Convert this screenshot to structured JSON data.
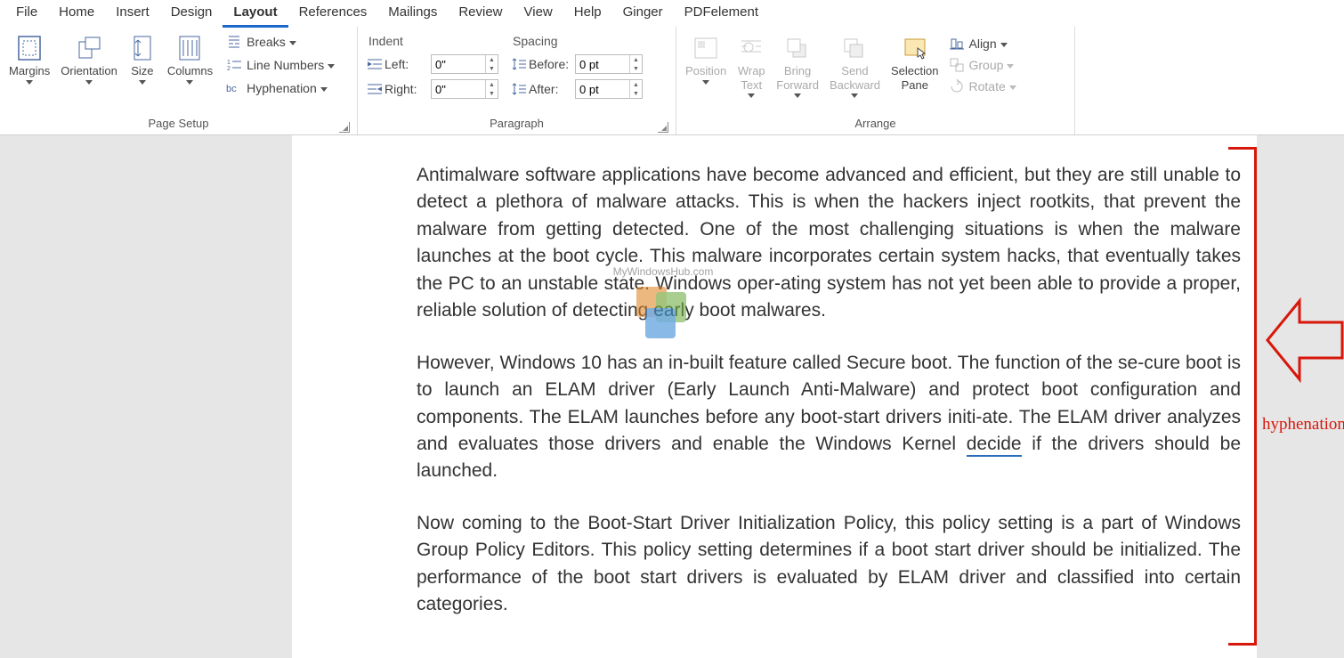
{
  "tabs": [
    "File",
    "Home",
    "Insert",
    "Design",
    "Layout",
    "References",
    "Mailings",
    "Review",
    "View",
    "Help",
    "Ginger",
    "PDFelement"
  ],
  "active_tab_index": 4,
  "page_setup": {
    "group_label": "Page Setup",
    "margins": "Margins",
    "orientation": "Orientation",
    "size": "Size",
    "columns": "Columns",
    "breaks": "Breaks",
    "line_numbers": "Line Numbers",
    "hyphenation": "Hyphenation"
  },
  "paragraph": {
    "group_label": "Paragraph",
    "indent_title": "Indent",
    "spacing_title": "Spacing",
    "left_label": "Left:",
    "right_label": "Right:",
    "before_label": "Before:",
    "after_label": "After:",
    "left_value": "0\"",
    "right_value": "0\"",
    "before_value": "0 pt",
    "after_value": "0 pt"
  },
  "arrange": {
    "group_label": "Arrange",
    "position": "Position",
    "wrap_text": "Wrap\nText",
    "bring_forward": "Bring\nForward",
    "send_backward": "Send\nBackward",
    "selection_pane": "Selection\nPane",
    "align": "Align",
    "group": "Group",
    "rotate": "Rotate"
  },
  "document": {
    "para1": "Antimalware software applications have become advanced and efficient, but they are still unable to detect a plethora of malware attacks. This is when the hackers inject rootkits, that prevent the malware from getting detected. One of the most challenging situations is when the malware launches at the boot cycle. This malware incorporates certain system hacks, that eventually takes the PC to an unstable state. Windows oper‐ating system has not yet been able to provide a proper, reliable solution of detecting early boot malwares.",
    "para2a": "However, Windows 10 has an in-built feature called Secure boot. The function of the se‐cure boot is to launch an ELAM driver (Early Launch Anti-Malware) and protect boot configuration and components. The ELAM launches before any boot-start drivers initi‐ate. The ELAM driver analyzes and evaluates those drivers and enable the Windows Kernel ",
    "para2_link": "decide",
    "para2b": " if the drivers should be launched.",
    "para3": "Now coming to the Boot-Start Driver Initialization Policy, this policy setting is a part of Windows Group Policy Editors. This policy setting determines if a boot start driver should be initialized.  The performance of the boot start drivers is evaluated by ELAM driver and classified into certain categories."
  },
  "callout": "hyphenation",
  "watermark_text": "MyWindowsHub.com"
}
